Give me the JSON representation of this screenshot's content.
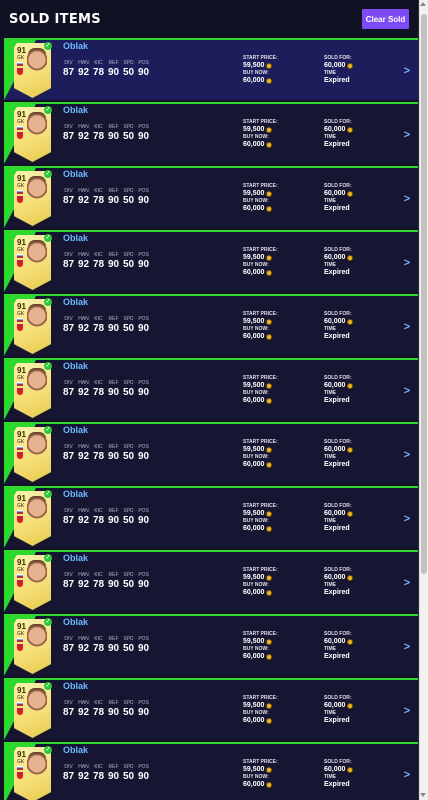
{
  "header": {
    "title": "SOLD ITEMS",
    "clear_label": "Clear Sold"
  },
  "items": [
    {
      "name": "Oblak",
      "rating": "91",
      "position": "GK",
      "stats": [
        {
          "label": "DIV",
          "value": "87"
        },
        {
          "label": "HAN",
          "value": "92"
        },
        {
          "label": "KIC",
          "value": "78"
        },
        {
          "label": "REF",
          "value": "90"
        },
        {
          "label": "SPD",
          "value": "50"
        },
        {
          "label": "POS",
          "value": "90"
        }
      ],
      "start_price_label": "START PRICE:",
      "start_price": "59,500",
      "buy_now_label": "BUY NOW:",
      "buy_now": "60,000",
      "sold_for_label": "SOLD FOR:",
      "sold_for": "60,000",
      "time_label": "TIME",
      "time": "Expired"
    },
    {
      "name": "Oblak",
      "rating": "91",
      "position": "GK",
      "stats": [
        {
          "label": "DIV",
          "value": "87"
        },
        {
          "label": "HAN",
          "value": "92"
        },
        {
          "label": "KIC",
          "value": "78"
        },
        {
          "label": "REF",
          "value": "90"
        },
        {
          "label": "SPD",
          "value": "50"
        },
        {
          "label": "POS",
          "value": "90"
        }
      ],
      "start_price_label": "START PRICE:",
      "start_price": "59,500",
      "buy_now_label": "BUY NOW:",
      "buy_now": "60,000",
      "sold_for_label": "SOLD FOR:",
      "sold_for": "60,000",
      "time_label": "TIME",
      "time": "Expired"
    },
    {
      "name": "Oblak",
      "rating": "91",
      "position": "GK",
      "stats": [
        {
          "label": "DIV",
          "value": "87"
        },
        {
          "label": "HAN",
          "value": "92"
        },
        {
          "label": "KIC",
          "value": "78"
        },
        {
          "label": "REF",
          "value": "90"
        },
        {
          "label": "SPD",
          "value": "50"
        },
        {
          "label": "POS",
          "value": "90"
        }
      ],
      "start_price_label": "START PRICE:",
      "start_price": "59,500",
      "buy_now_label": "BUY NOW:",
      "buy_now": "60,000",
      "sold_for_label": "SOLD FOR:",
      "sold_for": "60,000",
      "time_label": "TIME",
      "time": "Expired"
    },
    {
      "name": "Oblak",
      "rating": "91",
      "position": "GK",
      "stats": [
        {
          "label": "DIV",
          "value": "87"
        },
        {
          "label": "HAN",
          "value": "92"
        },
        {
          "label": "KIC",
          "value": "78"
        },
        {
          "label": "REF",
          "value": "90"
        },
        {
          "label": "SPD",
          "value": "50"
        },
        {
          "label": "POS",
          "value": "90"
        }
      ],
      "start_price_label": "START PRICE:",
      "start_price": "59,500",
      "buy_now_label": "BUY NOW:",
      "buy_now": "60,000",
      "sold_for_label": "SOLD FOR:",
      "sold_for": "60,000",
      "time_label": "TIME",
      "time": "Expired"
    },
    {
      "name": "Oblak",
      "rating": "91",
      "position": "GK",
      "stats": [
        {
          "label": "DIV",
          "value": "87"
        },
        {
          "label": "HAN",
          "value": "92"
        },
        {
          "label": "KIC",
          "value": "78"
        },
        {
          "label": "REF",
          "value": "90"
        },
        {
          "label": "SPD",
          "value": "50"
        },
        {
          "label": "POS",
          "value": "90"
        }
      ],
      "start_price_label": "START PRICE:",
      "start_price": "59,500",
      "buy_now_label": "BUY NOW:",
      "buy_now": "60,000",
      "sold_for_label": "SOLD FOR:",
      "sold_for": "60,000",
      "time_label": "TIME",
      "time": "Expired"
    },
    {
      "name": "Oblak",
      "rating": "91",
      "position": "GK",
      "stats": [
        {
          "label": "DIV",
          "value": "87"
        },
        {
          "label": "HAN",
          "value": "92"
        },
        {
          "label": "KIC",
          "value": "78"
        },
        {
          "label": "REF",
          "value": "90"
        },
        {
          "label": "SPD",
          "value": "50"
        },
        {
          "label": "POS",
          "value": "90"
        }
      ],
      "start_price_label": "START PRICE:",
      "start_price": "59,500",
      "buy_now_label": "BUY NOW:",
      "buy_now": "60,000",
      "sold_for_label": "SOLD FOR:",
      "sold_for": "60,000",
      "time_label": "TIME",
      "time": "Expired"
    },
    {
      "name": "Oblak",
      "rating": "91",
      "position": "GK",
      "stats": [
        {
          "label": "DIV",
          "value": "87"
        },
        {
          "label": "HAN",
          "value": "92"
        },
        {
          "label": "KIC",
          "value": "78"
        },
        {
          "label": "REF",
          "value": "90"
        },
        {
          "label": "SPD",
          "value": "50"
        },
        {
          "label": "POS",
          "value": "90"
        }
      ],
      "start_price_label": "START PRICE:",
      "start_price": "59,500",
      "buy_now_label": "BUY NOW:",
      "buy_now": "60,000",
      "sold_for_label": "SOLD FOR:",
      "sold_for": "60,000",
      "time_label": "TIME",
      "time": "Expired"
    },
    {
      "name": "Oblak",
      "rating": "91",
      "position": "GK",
      "stats": [
        {
          "label": "DIV",
          "value": "87"
        },
        {
          "label": "HAN",
          "value": "92"
        },
        {
          "label": "KIC",
          "value": "78"
        },
        {
          "label": "REF",
          "value": "90"
        },
        {
          "label": "SPD",
          "value": "50"
        },
        {
          "label": "POS",
          "value": "90"
        }
      ],
      "start_price_label": "START PRICE:",
      "start_price": "59,500",
      "buy_now_label": "BUY NOW:",
      "buy_now": "60,000",
      "sold_for_label": "SOLD FOR:",
      "sold_for": "60,000",
      "time_label": "TIME",
      "time": "Expired"
    },
    {
      "name": "Oblak",
      "rating": "91",
      "position": "GK",
      "stats": [
        {
          "label": "DIV",
          "value": "87"
        },
        {
          "label": "HAN",
          "value": "92"
        },
        {
          "label": "KIC",
          "value": "78"
        },
        {
          "label": "REF",
          "value": "90"
        },
        {
          "label": "SPD",
          "value": "50"
        },
        {
          "label": "POS",
          "value": "90"
        }
      ],
      "start_price_label": "START PRICE:",
      "start_price": "59,500",
      "buy_now_label": "BUY NOW:",
      "buy_now": "60,000",
      "sold_for_label": "SOLD FOR:",
      "sold_for": "60,000",
      "time_label": "TIME",
      "time": "Expired"
    },
    {
      "name": "Oblak",
      "rating": "91",
      "position": "GK",
      "stats": [
        {
          "label": "DIV",
          "value": "87"
        },
        {
          "label": "HAN",
          "value": "92"
        },
        {
          "label": "KIC",
          "value": "78"
        },
        {
          "label": "REF",
          "value": "90"
        },
        {
          "label": "SPD",
          "value": "50"
        },
        {
          "label": "POS",
          "value": "90"
        }
      ],
      "start_price_label": "START PRICE:",
      "start_price": "59,500",
      "buy_now_label": "BUY NOW:",
      "buy_now": "60,000",
      "sold_for_label": "SOLD FOR:",
      "sold_for": "60,000",
      "time_label": "TIME",
      "time": "Expired"
    },
    {
      "name": "Oblak",
      "rating": "91",
      "position": "GK",
      "stats": [
        {
          "label": "DIV",
          "value": "87"
        },
        {
          "label": "HAN",
          "value": "92"
        },
        {
          "label": "KIC",
          "value": "78"
        },
        {
          "label": "REF",
          "value": "90"
        },
        {
          "label": "SPD",
          "value": "50"
        },
        {
          "label": "POS",
          "value": "90"
        }
      ],
      "start_price_label": "START PRICE:",
      "start_price": "59,500",
      "buy_now_label": "BUY NOW:",
      "buy_now": "60,000",
      "sold_for_label": "SOLD FOR:",
      "sold_for": "60,000",
      "time_label": "TIME",
      "time": "Expired"
    },
    {
      "name": "Oblak",
      "rating": "91",
      "position": "GK",
      "stats": [
        {
          "label": "DIV",
          "value": "87"
        },
        {
          "label": "HAN",
          "value": "92"
        },
        {
          "label": "KIC",
          "value": "78"
        },
        {
          "label": "REF",
          "value": "90"
        },
        {
          "label": "SPD",
          "value": "50"
        },
        {
          "label": "POS",
          "value": "90"
        }
      ],
      "start_price_label": "START PRICE:",
      "start_price": "59,500",
      "buy_now_label": "BUY NOW:",
      "buy_now": "60,000",
      "sold_for_label": "SOLD FOR:",
      "sold_for": "60,000",
      "time_label": "TIME",
      "time": "Expired"
    }
  ],
  "colors": {
    "accent_green": "#2cd82c",
    "button_purple": "#7c4bf5",
    "name_blue": "#6db8ff",
    "coin_gold": "#e8b82a"
  },
  "icons": {
    "check": "check-icon",
    "coin": "coin-icon",
    "chevron": "chevron-right-icon"
  }
}
